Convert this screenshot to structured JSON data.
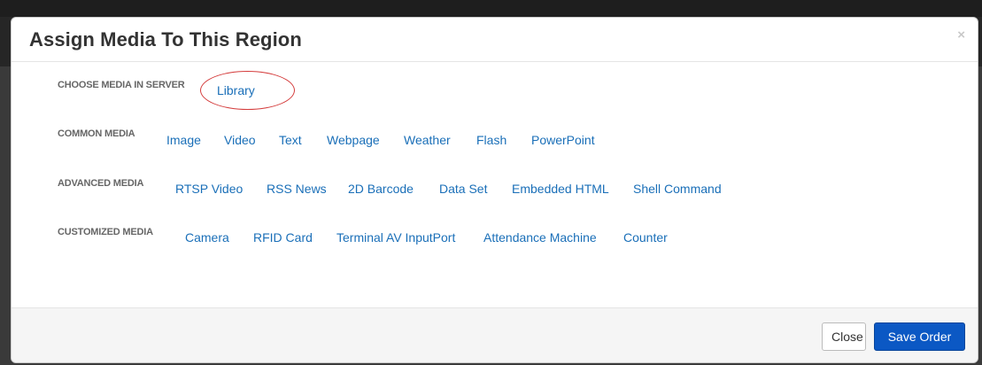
{
  "dialog": {
    "title": "Assign Media To This Region",
    "close_symbol": "×"
  },
  "sections": {
    "server": {
      "label": "CHOOSE MEDIA IN SERVER",
      "items": [
        "Library"
      ]
    },
    "common": {
      "label": "COMMON MEDIA",
      "items": [
        "Image",
        "Video",
        "Text",
        "Webpage",
        "Weather",
        "Flash",
        "PowerPoint"
      ]
    },
    "advanced": {
      "label": "ADVANCED MEDIA",
      "items": [
        "RTSP Video",
        "RSS News",
        "2D Barcode",
        "Data Set",
        "Embedded HTML",
        "Shell Command"
      ]
    },
    "customized": {
      "label": "CUSTOMIZED MEDIA",
      "items": [
        "Camera",
        "RFID Card",
        "Terminal AV InputPort",
        "Attendance Machine",
        "Counter"
      ]
    }
  },
  "footer": {
    "close_label": "Close",
    "save_label": "Save Order"
  },
  "annotation": {
    "color": "#d43b3b",
    "target": "Library"
  },
  "colors": {
    "link": "#1a6fb8",
    "primary": "#0b58c4"
  }
}
